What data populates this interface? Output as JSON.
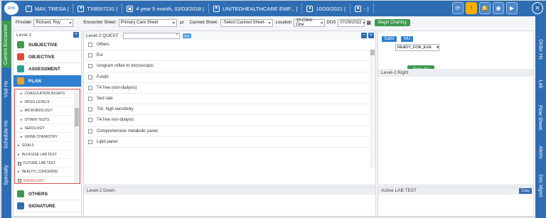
{
  "patient_bar": {
    "name": "MAY, TRESA |",
    "id": "TX8557231 |",
    "age": "4 year 5 month, 02/03/2018 |",
    "insurance": "UNITEDHEALTHCARE EMP... |",
    "visit_date": "10/20/2021 |",
    "extra": "- |",
    "logo_text": "EHR"
  },
  "left_tabs": [
    "Current Encounter",
    "Visit Hx",
    "Schedule Hx",
    "Specialty"
  ],
  "right_tabs": [
    "Order Hx",
    "Lab",
    "Flow Sheet",
    "Alerts",
    "Doc Mgmt"
  ],
  "toolbar": {
    "provider_label": "Provider",
    "provider_value": "Richard, Roy",
    "encounter_sheet_label": "Encounter Sheet:",
    "encounter_sheet_value": "Primary Care Sheet",
    "canned_sheet_label": "Canned Sheet:",
    "canned_sheet_value": "-Select Canned Sheet-",
    "location_label": "Location",
    "location_value": "10-Clinic One",
    "dos_label": "DOS",
    "dos_value": "07/29/2022",
    "begin_charting": "Begin Charting"
  },
  "level1": {
    "title": "Level-1",
    "sections": [
      {
        "label": "SUBJECTIVE",
        "color": "#3f9a4f"
      },
      {
        "label": "OBJECTIVE",
        "color": "#e04b3a"
      },
      {
        "label": "ASSESSMENT",
        "color": "#2aa198"
      },
      {
        "label": "PLAN",
        "color": "#f0a020"
      }
    ],
    "plan_items": [
      {
        "label": "COAGULATION ASSAYS",
        "kind": "caret",
        "sub": true
      },
      {
        "label": "DRUG LEVELS",
        "kind": "caret",
        "sub": true
      },
      {
        "label": "MICROBIOLOGY",
        "kind": "caret",
        "sub": true
      },
      {
        "label": "OTHER TESTS",
        "kind": "caret",
        "sub": true
      },
      {
        "label": "SEROLOGY",
        "kind": "caret",
        "sub": true
      },
      {
        "label": "URINE CHEMISTRY",
        "kind": "caret",
        "sub": true
      },
      {
        "label": "GOALS",
        "kind": "caret",
        "sub": false
      },
      {
        "label": "IN-HOUSE LAB TEST",
        "kind": "caret",
        "sub": false
      },
      {
        "label": "FUTURE LAB TEST",
        "kind": "box",
        "sub": false
      },
      {
        "label": "HEALTH_CONCERNS",
        "kind": "caret",
        "sub": false
      },
      {
        "label": "RADIOLOGY",
        "kind": "box",
        "sub": false
      }
    ],
    "bottom_sections": [
      {
        "label": "OTHERS",
        "color": "#3f9a4f"
      },
      {
        "label": "SIGNATURE",
        "color": "#2f6db3"
      }
    ]
  },
  "level2": {
    "title": "Level-2 QUEST",
    "badge": "ALL",
    "items": [
      "Others",
      "Esr",
      "Urogram reflex to microscopic",
      "Fshdh",
      "T4 free (non-dialysis)",
      "Sed rate",
      "Tsh. high sensitivity",
      "T4 free non-dialysis",
      "Comprehensive metabolic panel",
      "Lipid panel"
    ]
  },
  "right_panel": {
    "em_label": "E&M",
    "mu_label": "MU",
    "status_value": "READY_FOR_EXA",
    "save_as": "Save As",
    "level2_right": "Level-2 Right"
  },
  "bottom": {
    "level2_down": "Level-2 Down",
    "active_lab": "Active LAB TEST",
    "copy": "Copy"
  }
}
